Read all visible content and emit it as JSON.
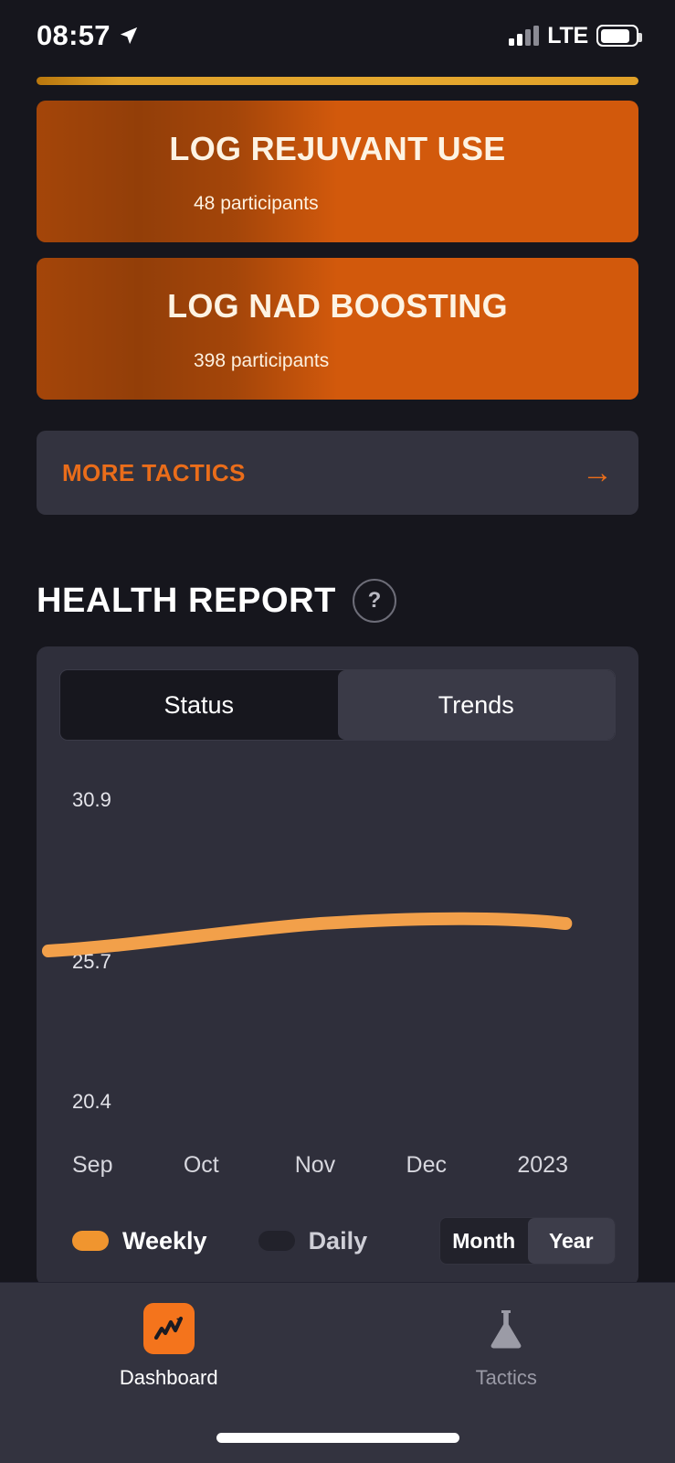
{
  "status_bar": {
    "time": "08:57",
    "location_icon": "location-arrow-icon",
    "network": "LTE",
    "signal_icon": "signal-bars-icon",
    "battery_icon": "battery-icon"
  },
  "tactics": {
    "cards": [
      {
        "title": "LOG REJUVANT USE",
        "subtitle": "48 participants"
      },
      {
        "title": "LOG NAD BOOSTING",
        "subtitle": "398 participants"
      }
    ],
    "more_label": "MORE TACTICS",
    "more_arrow": "→"
  },
  "health_report": {
    "title": "HEALTH REPORT",
    "help_glyph": "?",
    "tabs": [
      {
        "label": "Status",
        "selected": false
      },
      {
        "label": "Trends",
        "selected": true
      }
    ],
    "legend": [
      {
        "label": "Weekly",
        "active": true
      },
      {
        "label": "Daily",
        "active": false
      }
    ],
    "range": [
      {
        "label": "Month",
        "selected": false
      },
      {
        "label": "Year",
        "selected": true
      }
    ]
  },
  "chart_data": {
    "type": "line",
    "title": "HEALTH REPORT",
    "subtitle": "Trends",
    "xlabel": "",
    "ylabel": "",
    "grid": false,
    "legend_position": "bottom-left",
    "x": [
      "Sep",
      "Oct",
      "Nov",
      "Dec",
      "2023"
    ],
    "xtick_labels": [
      "Sep",
      "Oct",
      "Nov",
      "Dec",
      "2023"
    ],
    "ytick_labels": [
      "30.9",
      "25.7",
      "20.4"
    ],
    "ylim": [
      20.4,
      30.9
    ],
    "series": [
      {
        "name": "Weekly",
        "color": "#f2a04a",
        "values": [
          25.5,
          26.0,
          26.4,
          26.5,
          26.3
        ]
      }
    ]
  },
  "tabbar": {
    "items": [
      {
        "label": "Dashboard",
        "icon": "chart-line-icon",
        "active": true
      },
      {
        "label": "Tactics",
        "icon": "flask-icon",
        "active": false
      }
    ]
  }
}
